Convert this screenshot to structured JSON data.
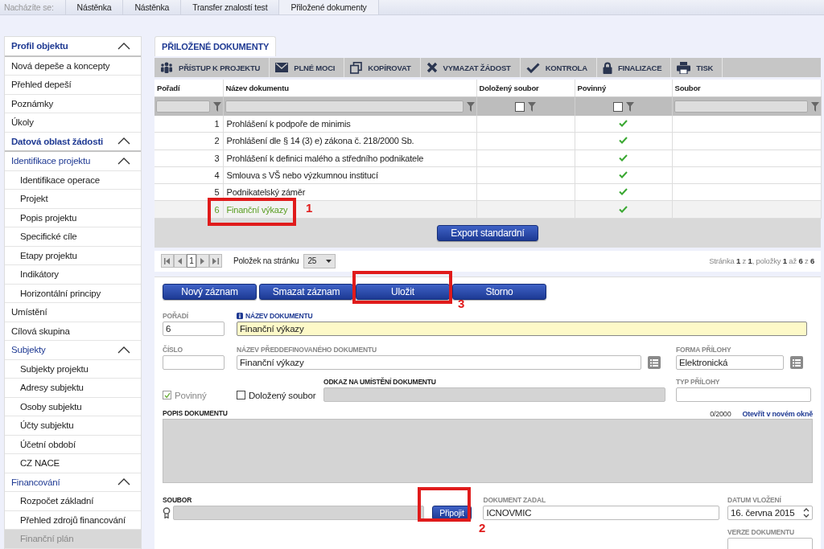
{
  "breadcrumb": {
    "label": "Nacházíte se:",
    "items": [
      "Nástěnka",
      "Nástěnka",
      "Transfer znalostí test",
      "Přiložené dokumenty"
    ]
  },
  "sidebar": {
    "items": [
      {
        "label": "Profil objektu",
        "kind": "section",
        "expanded": true,
        "children": [
          {
            "label": "Nová depeše a koncepty",
            "kind": "link",
            "selected": false
          },
          {
            "label": "Přehled depeší",
            "kind": "link",
            "selected": false
          },
          {
            "label": "Poznámky",
            "kind": "link",
            "selected": false
          },
          {
            "label": "Úkoly",
            "kind": "link",
            "selected": false
          }
        ]
      },
      {
        "label": "Datová oblast žádosti",
        "kind": "section",
        "expanded": true,
        "children": [
          {
            "label": "Identifikace projektu",
            "kind": "group",
            "expanded": true,
            "children": [
              {
                "label": "Identifikace operace",
                "kind": "link",
                "selected": false
              },
              {
                "label": "Projekt",
                "kind": "link",
                "selected": false
              },
              {
                "label": "Popis projektu",
                "kind": "link",
                "selected": false
              },
              {
                "label": "Specifické cíle",
                "kind": "link",
                "selected": false
              },
              {
                "label": "Etapy projektu",
                "kind": "link",
                "selected": false
              },
              {
                "label": "Indikátory",
                "kind": "link",
                "selected": false
              },
              {
                "label": "Horizontální principy",
                "kind": "link",
                "selected": false
              }
            ]
          },
          {
            "label": "Umístění",
            "kind": "link",
            "selected": false
          },
          {
            "label": "Cílová skupina",
            "kind": "link",
            "selected": false
          },
          {
            "label": "Subjekty",
            "kind": "group",
            "expanded": true,
            "children": [
              {
                "label": "Subjekty projektu",
                "kind": "link",
                "selected": false
              },
              {
                "label": "Adresy subjektu",
                "kind": "link",
                "selected": false
              },
              {
                "label": "Osoby subjektu",
                "kind": "link",
                "selected": false
              },
              {
                "label": "Účty subjektu",
                "kind": "link",
                "selected": false
              },
              {
                "label": "Účetní období",
                "kind": "link",
                "selected": false
              },
              {
                "label": "CZ NACE",
                "kind": "link",
                "selected": false
              }
            ]
          },
          {
            "label": "Financování",
            "kind": "group",
            "expanded": true,
            "children": [
              {
                "label": "Rozpočet základní",
                "kind": "link",
                "selected": false
              },
              {
                "label": "Přehled zdrojů financování",
                "kind": "link",
                "selected": false
              },
              {
                "label": "Finanční plán",
                "kind": "link",
                "selected": true
              }
            ]
          }
        ]
      }
    ]
  },
  "tabs": [
    {
      "label": "PŘILOŽENÉ DOKUMENTY",
      "selected": true
    }
  ],
  "toolbar": [
    {
      "label": "PŘÍSTUP K PROJEKTU",
      "kind": "people"
    },
    {
      "label": "PLNÉ MOCI",
      "kind": "mail"
    },
    {
      "label": "KOPÍROVAT",
      "kind": "copy"
    },
    {
      "label": "VYMAZAT ŽÁDOST",
      "kind": "cross"
    },
    {
      "label": "KONTROLA",
      "kind": "check"
    },
    {
      "label": "FINALIZACE",
      "kind": "lock"
    },
    {
      "label": "TISK",
      "kind": "print"
    }
  ],
  "table": {
    "columns": [
      {
        "label": "Pořadí",
        "kind": "text"
      },
      {
        "label": "Název dokumentu",
        "kind": "text"
      },
      {
        "label": "Doložený soubor",
        "kind": "checkbox",
        "checked": false
      },
      {
        "label": "Povinný",
        "kind": "checkbox",
        "checked": false
      },
      {
        "label": "Soubor",
        "kind": "text"
      }
    ],
    "rows": [
      {
        "order": "1",
        "name": "Prohlášení k podpoře de minimis",
        "required": true,
        "selected": false
      },
      {
        "order": "2",
        "name": "Prohlášení dle § 14 (3) e) zákona č. 218/2000 Sb.",
        "required": true,
        "selected": false
      },
      {
        "order": "3",
        "name": "Prohlášení k definici malého a středního podnikatele",
        "required": true,
        "selected": false
      },
      {
        "order": "4",
        "name": "Smlouva s VŠ nebo výzkumnou institucí",
        "required": true,
        "selected": false
      },
      {
        "order": "5",
        "name": "Podnikatelský záměr",
        "required": true,
        "selected": false
      },
      {
        "order": "6",
        "name": "Finanční výkazy",
        "required": true,
        "selected": true
      }
    ]
  },
  "export_button": "Export standardní",
  "pager": {
    "page": "1",
    "per_page_label": "Položek na stránku",
    "per_page": "25",
    "summary": "Stránka **1** z **1**, položky **1** až **6** z **6**"
  },
  "actions": [
    "Nový záznam",
    "Smazat záznam",
    "Uložit",
    "Storno"
  ],
  "form": {
    "order": {
      "label": "POŘADÍ",
      "value": "6"
    },
    "name": {
      "label": "NÁZEV DOKUMENTU",
      "value": "Finanční výkazy",
      "required": true
    },
    "number": {
      "label": "ČÍSLO"
    },
    "predefined": {
      "label": "NÁZEV PŘEDDEFINOVANÉHO DOKUMENTU",
      "value": "Finanční výkazy"
    },
    "attachment_form": {
      "label": "FORMA PŘÍLOHY",
      "value": "Elektronická"
    },
    "mandatory": {
      "label": "Povinný",
      "checked": true,
      "disabled": true
    },
    "file_attached": {
      "label": "Doložený soubor",
      "checked": false,
      "disabled": false
    },
    "location": {
      "label": "ODKAZ NA UMÍSTĚNÍ DOKUMENTU",
      "disabled": true
    },
    "attachment_type": {
      "label": "TYP PŘÍLOHY"
    },
    "description": {
      "label": "POPIS DOKUMENTU",
      "counter": "0/2000",
      "link": "Otevřít v novém okně",
      "disabled": true
    },
    "file": {
      "label": "SOUBOR",
      "button": "Připojit",
      "disabled": true
    },
    "entered_by": {
      "label": "DOKUMENT ZADAL",
      "value": "ICNOVMIC"
    },
    "date": {
      "label": "DATUM VLOŽENÍ",
      "value": "16. června 2015"
    },
    "version": {
      "label": "VERZE DOKUMENTU"
    }
  },
  "annotations": [
    {
      "label": "1"
    },
    {
      "label": "3"
    },
    {
      "label": "2"
    }
  ]
}
